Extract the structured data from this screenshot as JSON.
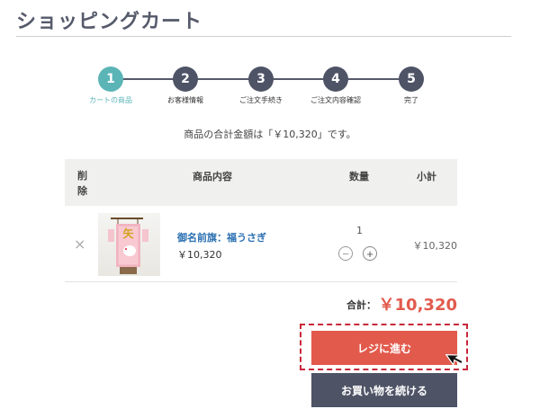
{
  "page": {
    "title": "ショッピングカート"
  },
  "steps": [
    {
      "num": "1",
      "label": "カートの商品",
      "active": true
    },
    {
      "num": "2",
      "label": "お客様情報",
      "active": false
    },
    {
      "num": "3",
      "label": "ご注文手続き",
      "active": false
    },
    {
      "num": "4",
      "label": "ご注文内容確認",
      "active": false
    },
    {
      "num": "5",
      "label": "完了",
      "active": false
    }
  ],
  "summary": "商品の合計金額は「￥10,320」です。",
  "table": {
    "headers": {
      "remove": "削除",
      "product": "商品内容",
      "quantity": "数量",
      "subtotal": "小計"
    }
  },
  "item": {
    "remove_symbol": "×",
    "image_text": "矢",
    "name": "御名前旗：福うさぎ",
    "price": "￥10,320",
    "quantity": "1",
    "minus": "−",
    "plus": "+",
    "subtotal": "￥10,320"
  },
  "total": {
    "label": "合計：",
    "value": "￥10,320"
  },
  "buttons": {
    "checkout": "レジに進む",
    "continue": "お買い物を続ける"
  },
  "colors": {
    "accent": "#5bb5b7",
    "primary": "#e25a4c",
    "dark": "#4e5366",
    "link": "#2a6fb1"
  }
}
